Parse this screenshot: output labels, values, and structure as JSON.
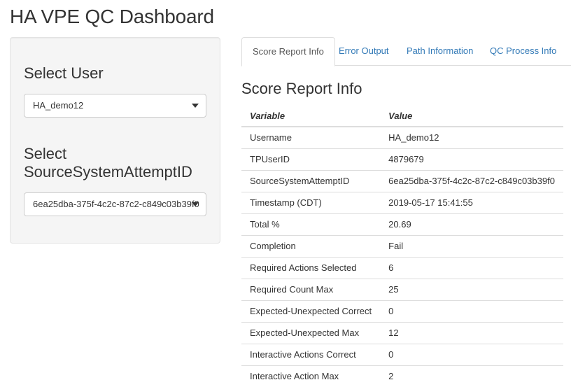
{
  "page": {
    "title": "HA VPE QC Dashboard"
  },
  "sidebar": {
    "user_label": "Select User",
    "user_value": "HA_demo12",
    "attempt_label_line1": "Select",
    "attempt_label_line2": "SourceSystemAttemptID",
    "attempt_value": "6ea25dba-375f-4c2c-87c2-c849c03b39f0"
  },
  "tabs": [
    {
      "label": "Score Report Info",
      "active": true
    },
    {
      "label": "Error Output",
      "active": false
    },
    {
      "label": "Path Information",
      "active": false
    },
    {
      "label": "QC Process Info",
      "active": false
    }
  ],
  "main": {
    "section_title": "Score Report Info",
    "table": {
      "headers": [
        "Variable",
        "Value"
      ],
      "rows": [
        [
          "Username",
          "HA_demo12"
        ],
        [
          "TPUserID",
          "4879679"
        ],
        [
          "SourceSystemAttemptID",
          "6ea25dba-375f-4c2c-87c2-c849c03b39f0"
        ],
        [
          "Timestamp (CDT)",
          "2019-05-17 15:41:55"
        ],
        [
          "Total %",
          "20.69"
        ],
        [
          "Completion",
          "Fail"
        ],
        [
          "Required Actions Selected",
          "6"
        ],
        [
          "Required Count Max",
          "25"
        ],
        [
          "Expected-Unexpected Correct",
          "0"
        ],
        [
          "Expected-Unexpected Max",
          "12"
        ],
        [
          "Interactive Actions Correct",
          "0"
        ],
        [
          "Interactive Action Max",
          "2"
        ]
      ]
    }
  },
  "icons": {
    "dropdown": "caret-down-icon"
  }
}
